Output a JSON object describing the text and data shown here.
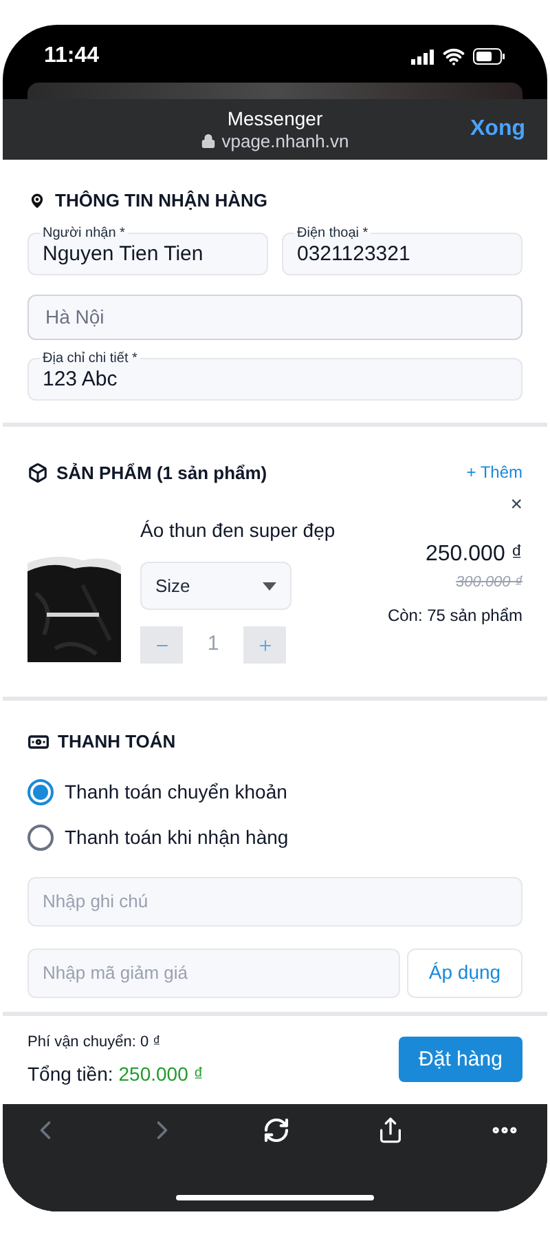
{
  "status_bar": {
    "time": "11:44"
  },
  "browser_header": {
    "title": "Messenger",
    "url": "vpage.nhanh.vn",
    "done": "Xong"
  },
  "shipping": {
    "title": "THÔNG TIN NHẬN HÀNG",
    "fields": [
      {
        "kind": "labeled",
        "label": "Người nhận *",
        "value": "Nguyen Tien Tien"
      },
      {
        "kind": "labeled",
        "label": "Điện thoại *",
        "value": "0321123321"
      },
      {
        "kind": "plain",
        "placeholder": "Hà Nội"
      },
      {
        "kind": "labeled",
        "label": "Địa chỉ chi tiết *",
        "value": "123 Abc"
      }
    ]
  },
  "products": {
    "title": "SẢN PHẨM (1 sản phẩm)",
    "add": "+ Thêm",
    "items": [
      {
        "kind": "picture",
        "name": "Áo thun đen super đẹp",
        "size_placeholder": "Size",
        "quantity": "1",
        "price": "250.000 ₫",
        "old_price": "300.000 ₫",
        "stock": "Còn: 75 sản phẩm",
        "remove": "×"
      }
    ]
  },
  "payment": {
    "title": "THANH TOÁN",
    "options": [
      {
        "label": "Thanh toán chuyển khoản",
        "selected": true
      },
      {
        "label": "Thanh toán khi nhận hàng",
        "selected": false
      }
    ],
    "note": {
      "placeholder": "Nhập ghi chú"
    },
    "coupon": {
      "placeholder": "Nhập mã giảm giá",
      "button": "Áp dụng"
    }
  },
  "footer": {
    "shipping_fee": "Phí vận chuyển: 0 ₫",
    "total_label": "Tổng tiền:",
    "total": "250.000 ₫",
    "order": "Đặt hàng"
  },
  "toolbar": [
    {
      "kind": "back",
      "disabled": true
    },
    {
      "kind": "forward",
      "disabled": true
    },
    {
      "kind": "reload",
      "disabled": false
    },
    {
      "kind": "share",
      "disabled": false
    },
    {
      "kind": "more",
      "disabled": false
    }
  ]
}
